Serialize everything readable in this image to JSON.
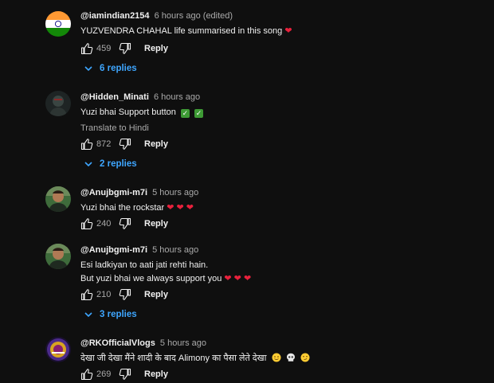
{
  "comments": [
    {
      "author": "@iamindian2154",
      "time": "6 hours ago",
      "edited": "(edited)",
      "text": "YUZVENDRA CHAHAL life summarised in this song",
      "likes": "459",
      "reply_label": "Reply",
      "replies_label": "6 replies"
    },
    {
      "author": "@Hidden_Minati",
      "time": "6 hours ago",
      "text": "Yuzi bhai Support button",
      "translate": "Translate to Hindi",
      "likes": "872",
      "reply_label": "Reply",
      "replies_label": "2 replies"
    },
    {
      "author": "@Anujbgmi-m7i",
      "time": "5 hours ago",
      "text": "Yuzi bhai the rockstar",
      "likes": "240",
      "reply_label": "Reply"
    },
    {
      "author": "@Anujbgmi-m7i",
      "time": "5 hours ago",
      "text_line1": "Esi ladkiyan to aati jati rehti hain.",
      "text_line2": "But yuzi bhai we always support you",
      "likes": "210",
      "reply_label": "Reply",
      "replies_label": "3 replies"
    },
    {
      "author": "@RKOfficialVlogs",
      "time": "5 hours ago",
      "text": "देखा जी देखा मैंने शादी के बाद Alimony का पैसा लेते देखा",
      "likes": "269",
      "reply_label": "Reply"
    }
  ],
  "colors": {
    "background": "#0f0f0f",
    "link": "#3ea6ff",
    "heart": "#e8213c"
  },
  "icons": [
    "india-flag-avatar",
    "like-icon",
    "dislike-icon",
    "chevron-down-icon",
    "heart-icon",
    "check-mark-icon",
    "smile-emoji",
    "skull-emoji",
    "smirk-emoji"
  ]
}
